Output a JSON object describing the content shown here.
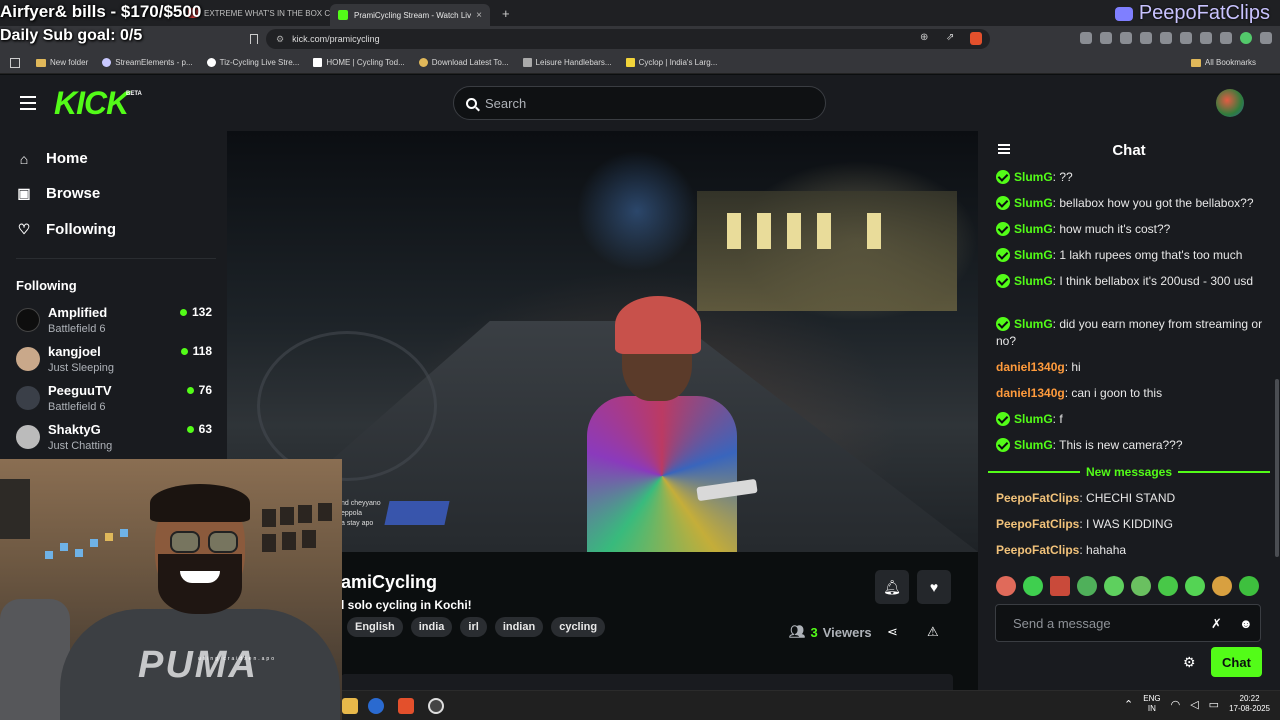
{
  "overlay": {
    "goal_bills": "Airfyer& bills - $170/$500",
    "sub_goal": "Daily Sub goal: 0/5",
    "brand": "PeepoFatClips"
  },
  "browser": {
    "tabs": [
      {
        "label": "EXTREME WHAT'S IN THE BOX C",
        "active": false
      },
      {
        "label": "PramiCycling Stream - Watch Liv",
        "active": true
      }
    ],
    "url": "kick.com/pramicycling",
    "bookmarks": [
      "New folder",
      "StreamElements - p...",
      "Tiz-Cycling Live Stre...",
      "HOME | Cycling Tod...",
      "Download Latest To...",
      "Leisure Handlebars...",
      "Cyclop | India's Larg..."
    ],
    "all_bookmarks": "All Bookmarks"
  },
  "header": {
    "logo": "KICK",
    "beta": "BETA",
    "search_placeholder": "Search"
  },
  "sidebar": {
    "nav": [
      {
        "label": "Home",
        "icon": "home-icon"
      },
      {
        "label": "Browse",
        "icon": "browse-icon"
      },
      {
        "label": "Following",
        "icon": "heart-icon"
      }
    ],
    "following_title": "Following",
    "following": [
      {
        "name": "Amplified",
        "category": "Battlefield 6",
        "viewers": "132"
      },
      {
        "name": "kangjoel",
        "category": "Just Sleeping",
        "viewers": "118"
      },
      {
        "name": "PeeguuTV",
        "category": "Battlefield 6",
        "viewers": "76"
      },
      {
        "name": "ShaktyG",
        "category": "Just Chatting",
        "viewers": "63"
      }
    ]
  },
  "video": {
    "subtitle_lines": [
      "nd cheyyano",
      "eppola",
      "a stay apo"
    ]
  },
  "channel": {
    "name": "amiCycling",
    "title": "l solo cycling in Kochi!",
    "tags": [
      "English",
      "india",
      "irl",
      "indian",
      "cycling"
    ],
    "viewers": "3",
    "viewers_label": "Viewers"
  },
  "webcam": {
    "shirt_text": "PUMA",
    "tiny_text": "using craidsen.apo"
  },
  "chat": {
    "title": "Chat",
    "messages": [
      {
        "user": "SlumG",
        "text": "??",
        "badge": true
      },
      {
        "user": "SlumG",
        "text": "bellabox how you got the bellabox??",
        "badge": true
      },
      {
        "user": "SlumG",
        "text": "how much it's cost??",
        "badge": true
      },
      {
        "user": "SlumG",
        "text": "1 lakh rupees omg that's too much",
        "badge": true
      },
      {
        "user": "SlumG",
        "text": "I think bellabox it's 200usd - 300 usd",
        "badge": true
      },
      {
        "user": "SlumG",
        "text": "did you earn money from streaming or no?",
        "badge": true
      },
      {
        "user": "daniel1340g",
        "text": "hi",
        "badge": false
      },
      {
        "user": "daniel1340g",
        "text": "can i goon to this",
        "badge": false
      },
      {
        "user": "SlumG",
        "text": "f",
        "badge": true
      },
      {
        "user": "SlumG",
        "text": "This is new camera???",
        "badge": true
      }
    ],
    "new_messages_label": "New messages",
    "new_messages": [
      {
        "user": "PeepoFatClips",
        "text": "CHECHI STAND"
      },
      {
        "user": "PeepoFatClips",
        "text": "I WAS KIDDING"
      },
      {
        "user": "PeepoFatClips",
        "text": "hahaha"
      }
    ],
    "input_placeholder": "Send a message",
    "send_label": "Chat"
  },
  "taskbar": {
    "lang_1": "ENG",
    "lang_2": "IN",
    "time": "20:22",
    "date": "17-08-2025"
  },
  "colors": {
    "kick_green": "#53fc18",
    "bg": "#0b0e0f",
    "panel": "#191b1f"
  }
}
